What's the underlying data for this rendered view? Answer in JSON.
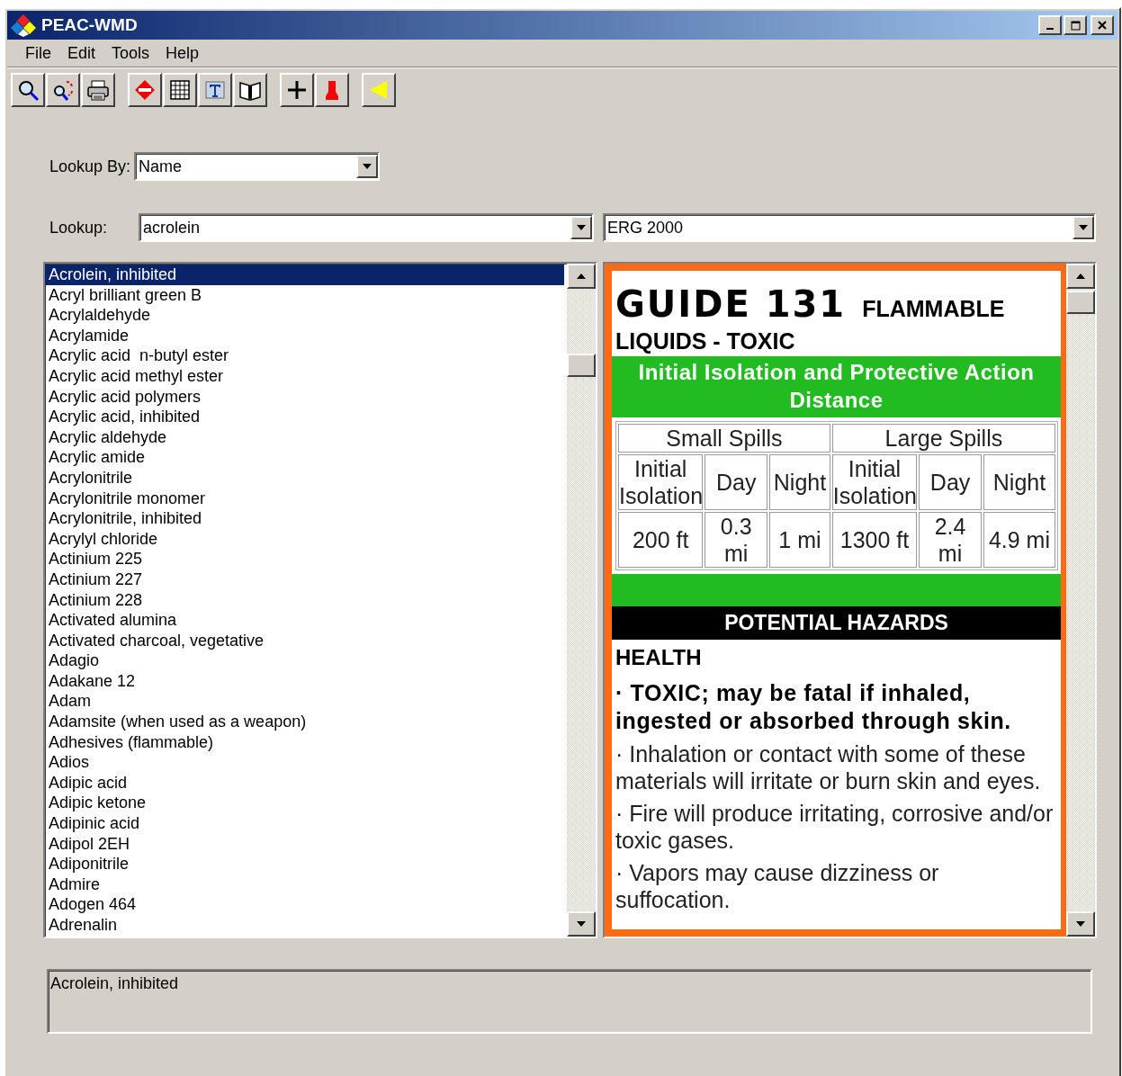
{
  "window": {
    "title": "PEAC-WMD"
  },
  "menu": [
    {
      "label": "File"
    },
    {
      "label": "Edit"
    },
    {
      "label": "Tools"
    },
    {
      "label": "Help"
    }
  ],
  "lookup_by": {
    "label": "Lookup By:",
    "value": "Name"
  },
  "lookup": {
    "label": "Lookup:",
    "value": "acrolein"
  },
  "guide_book": {
    "value": "ERG 2000"
  },
  "substances": [
    {
      "name": "Acrolein, inhibited",
      "selected": true
    },
    {
      "name": "Acryl brilliant green B",
      "selected": false
    },
    {
      "name": "Acrylaldehyde",
      "selected": false
    },
    {
      "name": "Acrylamide",
      "selected": false
    },
    {
      "name": "Acrylic acid  n-butyl ester",
      "selected": false
    },
    {
      "name": "Acrylic acid methyl ester",
      "selected": false
    },
    {
      "name": "Acrylic acid polymers",
      "selected": false
    },
    {
      "name": "Acrylic acid, inhibited",
      "selected": false
    },
    {
      "name": "Acrylic aldehyde",
      "selected": false
    },
    {
      "name": "Acrylic amide",
      "selected": false
    },
    {
      "name": "Acrylonitrile",
      "selected": false
    },
    {
      "name": "Acrylonitrile monomer",
      "selected": false
    },
    {
      "name": "Acrylonitrile, inhibited",
      "selected": false
    },
    {
      "name": "Acrylyl chloride",
      "selected": false
    },
    {
      "name": "Actinium 225",
      "selected": false
    },
    {
      "name": "Actinium 227",
      "selected": false
    },
    {
      "name": "Actinium 228",
      "selected": false
    },
    {
      "name": "Activated alumina",
      "selected": false
    },
    {
      "name": "Activated charcoal, vegetative",
      "selected": false
    },
    {
      "name": "Adagio",
      "selected": false
    },
    {
      "name": "Adakane 12",
      "selected": false
    },
    {
      "name": "Adam",
      "selected": false
    },
    {
      "name": "Adamsite (when used as a weapon)",
      "selected": false
    },
    {
      "name": "Adhesives (flammable)",
      "selected": false
    },
    {
      "name": "Adios",
      "selected": false
    },
    {
      "name": "Adipic acid",
      "selected": false
    },
    {
      "name": "Adipic ketone",
      "selected": false
    },
    {
      "name": "Adipinic acid",
      "selected": false
    },
    {
      "name": "Adipol 2EH",
      "selected": false
    },
    {
      "name": "Adiponitrile",
      "selected": false
    },
    {
      "name": "Admire",
      "selected": false
    },
    {
      "name": "Adogen 464",
      "selected": false
    },
    {
      "name": "Adrenalin",
      "selected": false
    }
  ],
  "guide": {
    "number": "GUIDE 131",
    "title_first": "FLAMMABLE",
    "title_second": "LIQUIDS - TOXIC",
    "isolation_heading": "Initial Isolation and Protective Action Distance",
    "spill_groups": [
      "Small Spills",
      "Large Spills"
    ],
    "columns": [
      "Initial Isolation",
      "Day",
      "Night",
      "Initial Isolation",
      "Day",
      "Night"
    ],
    "values": [
      "200 ft",
      "0.3 mi",
      "1 mi",
      "1300 ft",
      "2.4 mi",
      "4.9 mi"
    ],
    "hazards_heading": "POTENTIAL HAZARDS",
    "section": "HEALTH",
    "lead": "· TOXIC; may be fatal if inhaled, ingested or absorbed through skin.",
    "points": [
      "· Inhalation or contact with some of these materials will irritate or burn skin and eyes.",
      "· Fire will produce irritating, corrosive and/or toxic gases.",
      "· Vapors may cause dizziness or suffocation."
    ]
  },
  "status": {
    "text": "Acrolein, inhibited"
  }
}
